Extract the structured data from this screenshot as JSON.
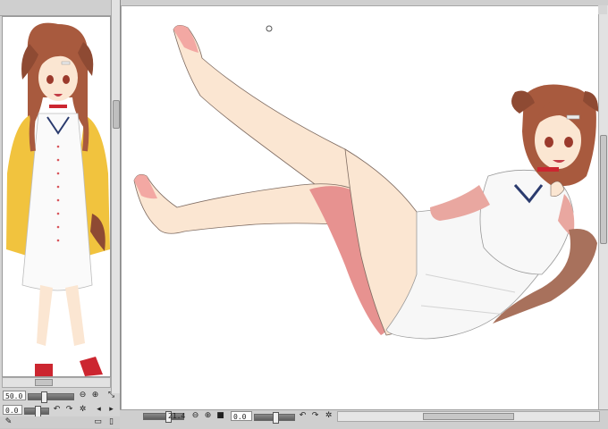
{
  "navigator": {
    "zoom_value": "50.0",
    "rotation_value": "0.0"
  },
  "canvas_status": {
    "zoom_value": "21.4",
    "rotation_value": "0.0"
  },
  "icons": {
    "zoom_out": "zoom-out-icon",
    "zoom_in": "zoom-in-icon",
    "fit": "fit-to-screen-icon",
    "rotate_left": "rotate-left-icon",
    "rotate_right": "rotate-right-icon",
    "reset_rotation": "reset-rotation-icon",
    "flip_horizontal": "flip-horizontal-icon",
    "flip_vertical": "flip-vertical-icon"
  },
  "colors": {
    "panel_bg": "#d4d4d4",
    "canvas_bg": "#ffffff",
    "hair": "#a0553c",
    "jacket": "#f1c33e",
    "skin": "#fbe6d2",
    "sock": "#cc2630"
  }
}
